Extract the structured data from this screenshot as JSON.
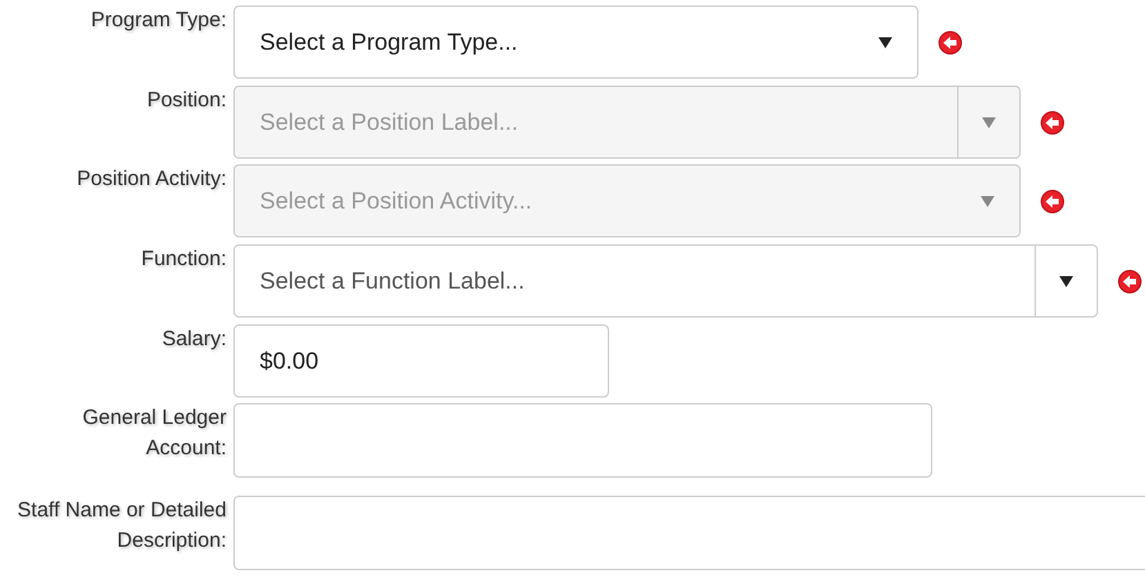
{
  "fields": [
    {
      "label": "Program Type:",
      "kind": "select",
      "placeholder": "Select a Program Type...",
      "disabled": false,
      "split": false,
      "required_marker": true
    },
    {
      "label": "Position:",
      "kind": "select",
      "placeholder": "Select a Position Label...",
      "disabled": true,
      "split": true,
      "required_marker": true
    },
    {
      "label": "Position Activity:",
      "kind": "select",
      "placeholder": "Select a Position Activity...",
      "disabled": true,
      "split": false,
      "required_marker": true
    },
    {
      "label": "Function:",
      "kind": "select",
      "placeholder": "Select a Function Label...",
      "disabled": false,
      "split": true,
      "required_marker": true
    },
    {
      "label": "Salary:",
      "kind": "text",
      "value": "$0.00"
    },
    {
      "label": "General Ledger Account:",
      "kind": "text"
    },
    {
      "label": "Staff Name or Detailed Description:",
      "kind": "text"
    }
  ]
}
